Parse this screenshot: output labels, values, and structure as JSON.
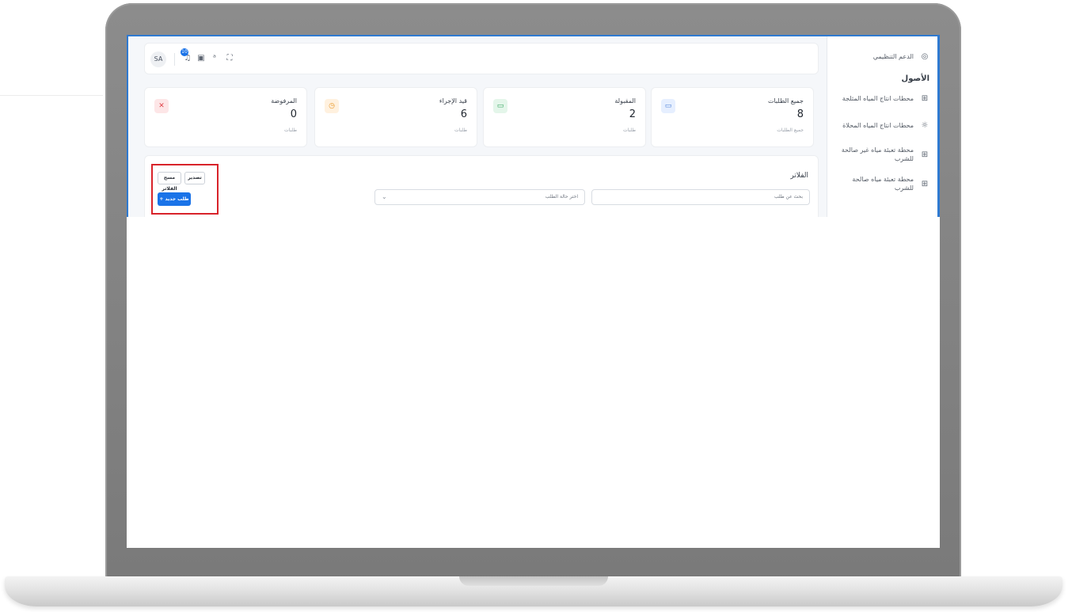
{
  "topbar": {
    "avatar_initials": "SA",
    "notification_count": "10",
    "icons": [
      "bell-icon",
      "clipboard-icon",
      "translate-icon",
      "fullscreen-icon"
    ]
  },
  "sidebar": {
    "support_label": "الدعم التنظيمي",
    "section_title": "الأصول",
    "items": [
      {
        "label": "محطات انتاج المياه المثلجة",
        "icon": "grid-icon"
      },
      {
        "label": "محطات انتاج المياه المحلاة",
        "icon": "sun-icon"
      },
      {
        "label": "محطة تعبئة مياه غير صالحة للشرب",
        "icon": "squares-icon"
      },
      {
        "label": "محطة تعبئة مياه صالحة للشرب",
        "icon": "squares-icon"
      }
    ]
  },
  "cards": [
    {
      "title": "جميع الطلبات",
      "value": "8",
      "subtitle": "جميع الطلبات",
      "icon": "monitor-icon",
      "color": "#4a7fd6",
      "bg": "#e6efff"
    },
    {
      "title": "المقبولة",
      "value": "2",
      "subtitle": "طلبات",
      "icon": "monitor-icon",
      "color": "#2fa35a",
      "bg": "#e4f6ea"
    },
    {
      "title": "قيد الإجراء",
      "value": "6",
      "subtitle": "طلبات",
      "icon": "clock-icon",
      "color": "#e89a2c",
      "bg": "#fff1df"
    },
    {
      "title": "المرفوضة",
      "value": "0",
      "subtitle": "طلبات",
      "icon": "file-x-icon",
      "color": "#e0434a",
      "bg": "#fde6e7"
    }
  ],
  "filters": {
    "title": "الفلاتر",
    "search_placeholder": "بحث عن طلب",
    "status_placeholder": "اختر حالة الطلب",
    "export_label": "تصدير",
    "clear_label": "مسح الفلاتر",
    "new_request_label": "+ طلب جديد"
  },
  "colors": {
    "primary": "#1a73e8",
    "highlight": "#d8232a",
    "frame_accent": "#2f7ad1"
  }
}
